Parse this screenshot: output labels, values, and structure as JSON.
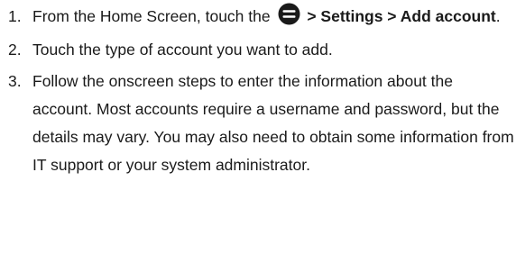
{
  "steps": [
    {
      "number": "1.",
      "text_before": "From the Home Screen, touch the",
      "icon": "menu-icon",
      "bold_path": " > Settings > Add account",
      "text_after": "."
    },
    {
      "number": "2.",
      "text": "Touch the type of account you want to add."
    },
    {
      "number": "3.",
      "text": "Follow the onscreen steps to enter the information about the account. Most accounts require a username and password, but the details may vary. You may also need to obtain some information from IT support or your system administrator."
    }
  ]
}
